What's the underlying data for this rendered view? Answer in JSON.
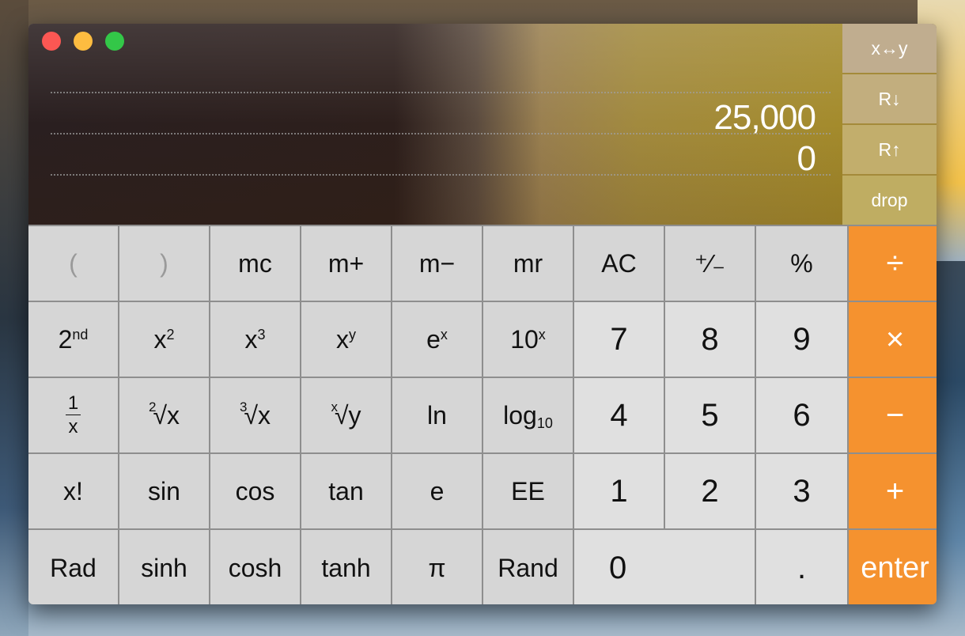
{
  "window": {
    "controls": [
      {
        "name": "close",
        "color": "#fc5753"
      },
      {
        "name": "minimize",
        "color": "#fdbc40"
      },
      {
        "name": "zoom",
        "color": "#33c748"
      }
    ]
  },
  "display": {
    "stack": [
      "25,000",
      "0"
    ]
  },
  "stack_buttons": [
    "x↔y",
    "R↓",
    "R↑",
    "drop"
  ],
  "colors": {
    "operator": "#f5922f",
    "function_key": "#d6d6d6",
    "digit_key": "#e0e0e0"
  },
  "keys": [
    {
      "id": "open-paren",
      "label": "(",
      "kind": "dim"
    },
    {
      "id": "close-paren",
      "label": ")",
      "kind": "dim"
    },
    {
      "id": "mc",
      "label": "mc"
    },
    {
      "id": "m-plus",
      "label": "m+"
    },
    {
      "id": "m-minus",
      "label": "m−"
    },
    {
      "id": "mr",
      "label": "mr"
    },
    {
      "id": "ac",
      "label": "AC"
    },
    {
      "id": "plus-minus",
      "label": "⁺∕₋"
    },
    {
      "id": "percent",
      "label": "%"
    },
    {
      "id": "divide",
      "label": "÷",
      "kind": "op"
    },
    {
      "id": "second",
      "label": "2",
      "sup": "nd"
    },
    {
      "id": "x-squared",
      "label": "x",
      "sup": "2"
    },
    {
      "id": "x-cubed",
      "label": "x",
      "sup": "3"
    },
    {
      "id": "x-to-y",
      "label": "x",
      "sup": "y"
    },
    {
      "id": "e-to-x",
      "label": "e",
      "sup": "x"
    },
    {
      "id": "ten-to-x",
      "label": "10",
      "sup": "x"
    },
    {
      "id": "seven",
      "label": "7",
      "kind": "digit"
    },
    {
      "id": "eight",
      "label": "8",
      "kind": "digit"
    },
    {
      "id": "nine",
      "label": "9",
      "kind": "digit"
    },
    {
      "id": "multiply",
      "label": "×",
      "kind": "op"
    },
    {
      "id": "reciprocal",
      "num": "1",
      "den": "x",
      "kind": "frac"
    },
    {
      "id": "square-root",
      "pre": "2",
      "label": "√x"
    },
    {
      "id": "cube-root",
      "pre": "3",
      "label": "√x"
    },
    {
      "id": "y-root-x",
      "pre": "x",
      "label": "√y"
    },
    {
      "id": "ln",
      "label": "ln"
    },
    {
      "id": "log10",
      "label": "log",
      "sub": "10"
    },
    {
      "id": "four",
      "label": "4",
      "kind": "digit"
    },
    {
      "id": "five",
      "label": "5",
      "kind": "digit"
    },
    {
      "id": "six",
      "label": "6",
      "kind": "digit"
    },
    {
      "id": "subtract",
      "label": "−",
      "kind": "op"
    },
    {
      "id": "factorial",
      "label": "x!"
    },
    {
      "id": "sin",
      "label": "sin"
    },
    {
      "id": "cos",
      "label": "cos"
    },
    {
      "id": "tan",
      "label": "tan"
    },
    {
      "id": "e",
      "label": "e"
    },
    {
      "id": "ee",
      "label": "EE"
    },
    {
      "id": "one",
      "label": "1",
      "kind": "digit"
    },
    {
      "id": "two",
      "label": "2",
      "kind": "digit"
    },
    {
      "id": "three",
      "label": "3",
      "kind": "digit"
    },
    {
      "id": "add",
      "label": "+",
      "kind": "op"
    },
    {
      "id": "rad",
      "label": "Rad"
    },
    {
      "id": "sinh",
      "label": "sinh"
    },
    {
      "id": "cosh",
      "label": "cosh"
    },
    {
      "id": "tanh",
      "label": "tanh"
    },
    {
      "id": "pi",
      "label": "π"
    },
    {
      "id": "rand",
      "label": "Rand"
    },
    {
      "id": "zero",
      "label": "0",
      "kind": "digit zero"
    },
    {
      "id": "decimal",
      "label": ".",
      "kind": "digit"
    },
    {
      "id": "enter",
      "label": "enter",
      "kind": "op enter"
    }
  ]
}
